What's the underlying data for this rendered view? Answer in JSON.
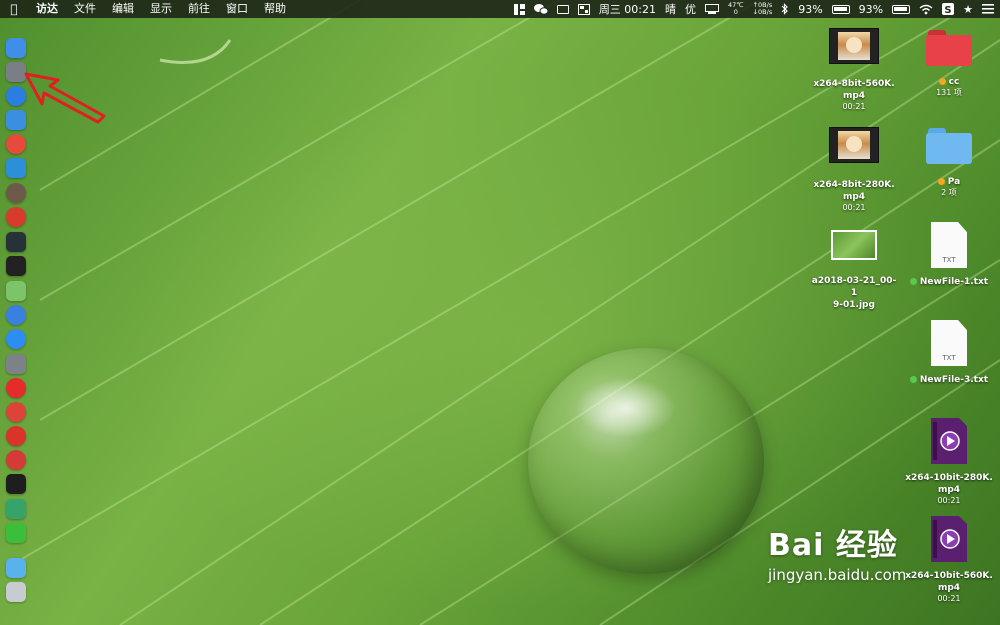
{
  "menubar": {
    "app_name": "访达",
    "items": [
      "文件",
      "编辑",
      "显示",
      "前往",
      "窗口",
      "帮助"
    ],
    "clock": "周三 00:21",
    "weather": "晴",
    "quality": "优",
    "temp_top": "47℃",
    "temp_bottom": "0",
    "net_up": "↑0B/s",
    "net_down": "↓0B/s",
    "battery_1": "93%",
    "battery_2": "93%"
  },
  "desktop_icons": [
    {
      "type": "video",
      "name_line1": "x264-8bit-560K.",
      "name_line2": "mp4",
      "sub": "00:21"
    },
    {
      "type": "folder_red",
      "name_line1": "cc",
      "sub": "131 项",
      "tag_color": "#f5a623"
    },
    {
      "type": "video",
      "name_line1": "x264-8bit-280K.",
      "name_line2": "mp4",
      "sub": "00:21"
    },
    {
      "type": "folder_blue",
      "name_line1": "Pa",
      "sub": "2 项",
      "tag_color": "#f5a623"
    },
    {
      "type": "jpg",
      "name_line1": "a2018-03-21_00-1",
      "name_line2": "9-01.jpg"
    },
    {
      "type": "txt",
      "name_line1": "NewFile-1.txt",
      "tag_color": "#5ac84a",
      "badge": "TXT"
    },
    {
      "type": "txt",
      "name_line1": "NewFile-3.txt",
      "tag_color": "#5ac84a",
      "badge": "TXT"
    },
    {
      "type": "mp4",
      "name_line1": "x264-10bit-280K.",
      "name_line2": "mp4",
      "sub": "00:21"
    },
    {
      "type": "mp4",
      "name_line1": "x264-10bit-560K.",
      "name_line2": "mp4",
      "sub": "00:21"
    }
  ],
  "dock": [
    {
      "name": "finder-icon",
      "color": "#3f8ee8"
    },
    {
      "name": "launchpad-icon",
      "color": "#7a7f86"
    },
    {
      "name": "safari-icon",
      "color": "#2a7de1"
    },
    {
      "name": "preview-icon",
      "color": "#3b8fe0"
    },
    {
      "name": "app-red-icon",
      "color": "#e54a3c"
    },
    {
      "name": "migration-icon",
      "color": "#2d8fd8"
    },
    {
      "name": "app-brown-icon",
      "color": "#6d5a4a"
    },
    {
      "name": "app-red-stripes-icon",
      "color": "#d63b2b"
    },
    {
      "name": "activity-monitor-icon",
      "color": "#263238"
    },
    {
      "name": "terminal-icon",
      "color": "#222222"
    },
    {
      "name": "maps-icon",
      "color": "#7cc36a"
    },
    {
      "name": "siri-icon",
      "color": "#3a80e0"
    },
    {
      "name": "app-store-icon",
      "color": "#2e8df0"
    },
    {
      "name": "system-preferences-icon",
      "color": "#7d8288"
    },
    {
      "name": "yandex-icon",
      "color": "#e52b2b"
    },
    {
      "name": "chrome-icon",
      "color": "#db4437"
    },
    {
      "name": "netease-music-icon",
      "color": "#d9332a"
    },
    {
      "name": "vivaldi-icon",
      "color": "#d43a36"
    },
    {
      "name": "iterm-icon",
      "color": "#1e1e1e"
    },
    {
      "name": "app-green-icon",
      "color": "#36a36a"
    },
    {
      "name": "wechat-icon",
      "color": "#3bbf3b"
    },
    {
      "name": "downloads-folder-icon",
      "color": "#5ab2ea"
    },
    {
      "name": "trash-icon",
      "color": "#c8ccd0"
    }
  ],
  "watermark": {
    "brand": "Bai 经验",
    "url": "jingyan.baidu.com"
  },
  "colors": {
    "annotation_arrow": "#e02020",
    "menubar_bg": "#1e2819"
  }
}
